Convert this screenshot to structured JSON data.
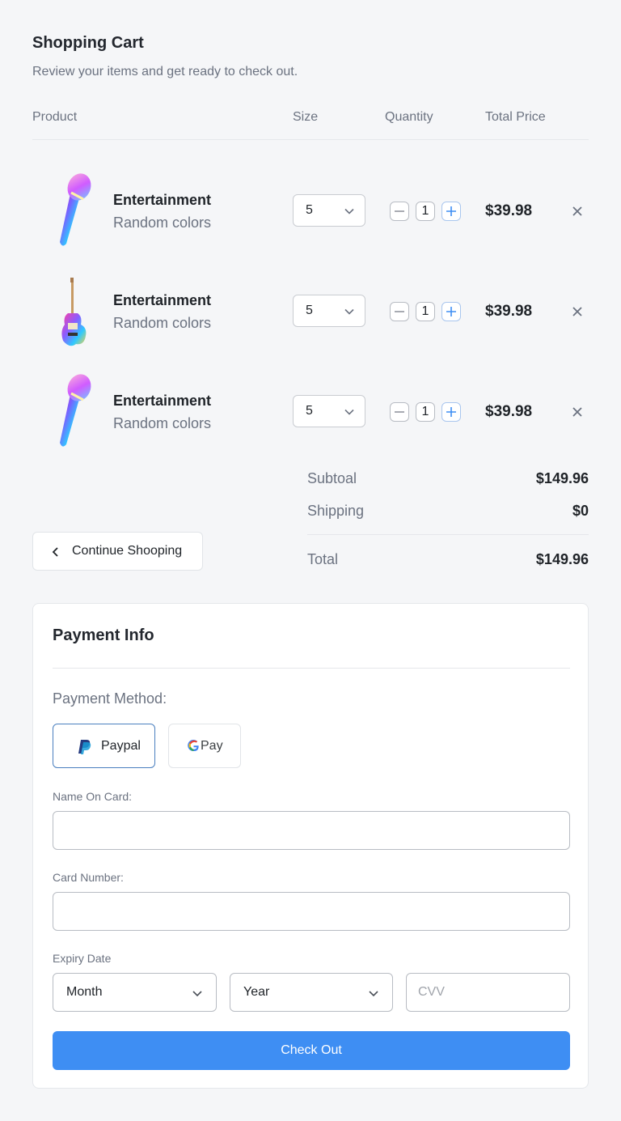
{
  "header": {
    "title": "Shopping Cart",
    "subtitle": "Review your items and get ready to check out."
  },
  "table": {
    "columns": [
      "Product",
      "Size",
      "Quantity",
      "Total Price"
    ]
  },
  "items": [
    {
      "name": "Entertainment",
      "variant": "Random colors",
      "size": "5",
      "quantity": "1",
      "price": "$39.98",
      "image": "microphone"
    },
    {
      "name": "Entertainment",
      "variant": "Random colors",
      "size": "5",
      "quantity": "1",
      "price": "$39.98",
      "image": "guitar"
    },
    {
      "name": "Entertainment",
      "variant": "Random colors",
      "size": "5",
      "quantity": "1",
      "price": "$39.98",
      "image": "microphone"
    }
  ],
  "summary": {
    "subtotal_label": "Subtoal",
    "subtotal": "$149.96",
    "shipping_label": "Shipping",
    "shipping": "$0",
    "total_label": "Total",
    "total": "$149.96"
  },
  "continue_label": "Continue Shooping",
  "payment": {
    "title": "Payment Info",
    "method_label": "Payment Method:",
    "methods": [
      {
        "label": "Paypal",
        "icon": "paypal-icon",
        "selected": true
      },
      {
        "label": "Pay",
        "icon": "google-icon",
        "selected": false
      }
    ],
    "name_label": "Name On Card:",
    "name_value": "",
    "card_label": "Card Number:",
    "card_value": "",
    "expiry_label": "Expiry Date",
    "month": "Month",
    "year": "Year",
    "cvv_placeholder": "CVV",
    "checkout_label": "Check Out"
  },
  "colors": {
    "accent": "#3e8ef3",
    "muted_text": "#6b7280",
    "border": "#e5e7eb"
  }
}
